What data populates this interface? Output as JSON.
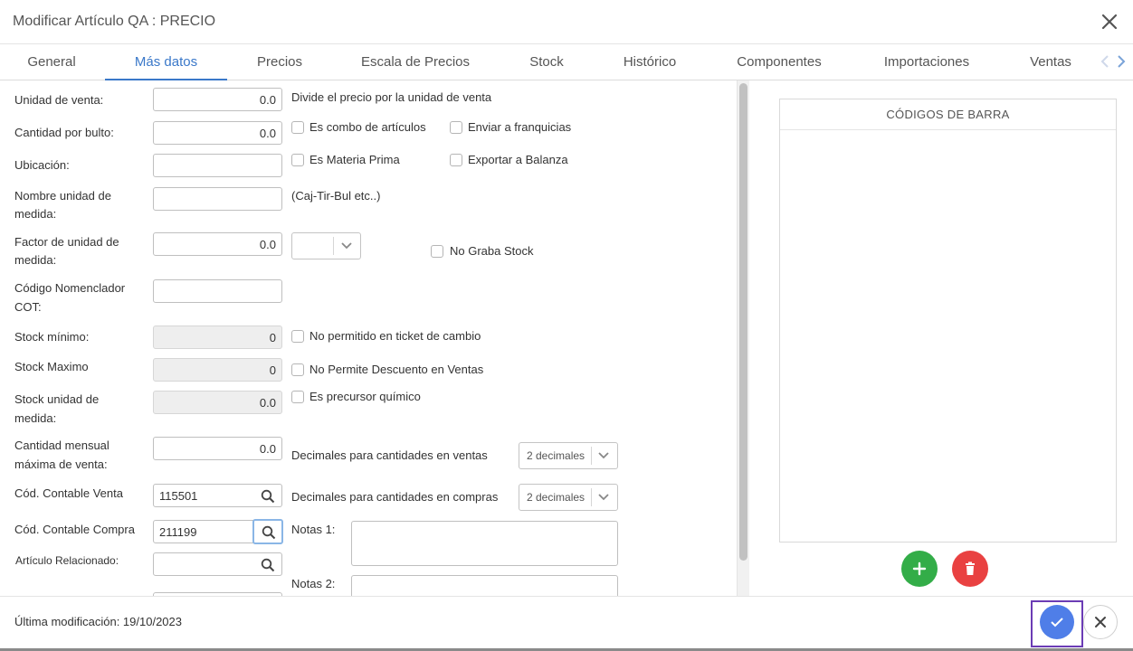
{
  "window": {
    "title": "Modificar Artículo QA : PRECIO"
  },
  "tabs": [
    {
      "label": "General"
    },
    {
      "label": "Más datos"
    },
    {
      "label": "Precios"
    },
    {
      "label": "Escala de Precios"
    },
    {
      "label": "Stock"
    },
    {
      "label": "Histórico"
    },
    {
      "label": "Componentes"
    },
    {
      "label": "Importaciones"
    },
    {
      "label": "Ventas"
    }
  ],
  "active_tab": "Más datos",
  "form": {
    "unidad_venta": {
      "label": "Unidad de venta:",
      "value": "0.0",
      "hint": "Divide el precio por la unidad de venta"
    },
    "cantidad_bulto": {
      "label": "Cantidad por bulto:",
      "value": "0.0"
    },
    "ubicacion": {
      "label": "Ubicación:",
      "value": ""
    },
    "nombre_unidad": {
      "label_line1": "Nombre unidad de",
      "label_line2": "medida:",
      "value": "",
      "hint": "(Caj-Tir-Bul etc..)"
    },
    "factor_unidad": {
      "label_line1": "Factor de unidad de",
      "label_line2": "medida:",
      "value": "0.0",
      "select_value": ""
    },
    "codigo_nomenclador": {
      "label_line1": "Código Nomenclador",
      "label_line2": "COT:",
      "value": ""
    },
    "stock_minimo": {
      "label": "Stock mínimo:",
      "value": "0"
    },
    "stock_maximo": {
      "label": "Stock Maximo",
      "value": "0"
    },
    "stock_unidad": {
      "label_line1": "Stock unidad de",
      "label_line2": "medida:",
      "value": "0.0"
    },
    "cantidad_mensual": {
      "label_line1": "Cantidad mensual",
      "label_line2": "máxima de venta:",
      "value": "0.0"
    },
    "cod_contable_venta": {
      "label": "Cód. Contable Venta",
      "value": "115501"
    },
    "cod_contable_compra": {
      "label": "Cód. Contable Compra",
      "value": "211199"
    },
    "articulo_relacionado": {
      "label": "Artículo Relacionado:",
      "value": ""
    },
    "checkboxes": {
      "combo": {
        "label": "Es combo de artículos",
        "checked": false
      },
      "franquicias": {
        "label": "Enviar a franquicias",
        "checked": false
      },
      "materia_prima": {
        "label": "Es Materia Prima",
        "checked": false
      },
      "balanza": {
        "label": "Exportar a Balanza",
        "checked": false
      },
      "no_graba_stock": {
        "label": "No Graba Stock",
        "checked": false
      },
      "no_ticket_cambio": {
        "label": "No permitido en ticket de cambio",
        "checked": false
      },
      "no_descuento": {
        "label": "No Permite Descuento en Ventas",
        "checked": false
      },
      "precursor": {
        "label": "Es precursor químico",
        "checked": false
      }
    },
    "decimales_ventas": {
      "label": "Decimales para cantidades en ventas",
      "value": "2 decimales"
    },
    "decimales_compras": {
      "label": "Decimales para cantidades en compras",
      "value": "2 decimales"
    },
    "notas1": {
      "label": "Notas 1:",
      "value": ""
    },
    "notas2": {
      "label": "Notas 2:",
      "value": ""
    }
  },
  "barcodes": {
    "title": "CÓDIGOS DE BARRA"
  },
  "footer": {
    "last_modified": "Última modificación: 19/10/2023"
  },
  "colors": {
    "accent": "#3a78c9",
    "add": "#33ad48",
    "delete": "#e94141",
    "confirm": "#4f7ee8"
  }
}
